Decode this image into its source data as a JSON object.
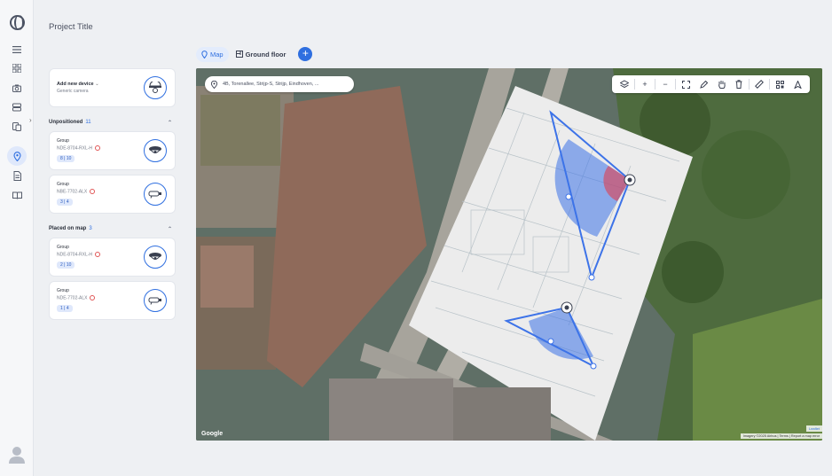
{
  "app": {
    "project_title": "Project Title"
  },
  "rail": {
    "items": [
      {
        "icon": "menu-icon"
      },
      {
        "icon": "grid-icon"
      },
      {
        "icon": "camera-icon"
      },
      {
        "icon": "server-icon"
      },
      {
        "icon": "devices-icon"
      },
      {
        "icon": "map-pin-icon",
        "active": true
      },
      {
        "icon": "document-icon"
      },
      {
        "icon": "book-icon"
      }
    ]
  },
  "panel": {
    "add_device": {
      "title": "Add new device",
      "subtitle": "Generic camera"
    },
    "unpositioned": {
      "label": "Unpositioned",
      "count": "11",
      "items": [
        {
          "group": "Group",
          "model": "NDE-8704-RXL-H",
          "chip": "8 | 10"
        },
        {
          "group": "Group",
          "model": "NBE-7702-ALX",
          "chip": "3 | 4"
        }
      ]
    },
    "placed": {
      "label": "Placed on map",
      "count": "3",
      "items": [
        {
          "group": "Group",
          "model": "NDE-8704-RXL-H",
          "chip": "2 | 10"
        },
        {
          "group": "Group",
          "model": "NDE-7702-ALX",
          "chip": "1 | 4"
        }
      ]
    }
  },
  "tabs": {
    "map": "Map",
    "ground_floor": "Ground floor",
    "add": "+"
  },
  "map": {
    "address": "4B, Torenallee, Strijp-S, Strijp, Eindhoven, ...",
    "google": "Google",
    "attribution": "Imagery ©2025 Airbus  |  Terms  |  Report a map error",
    "leaflet": "Leaflet",
    "toolbar": [
      {
        "icon": "layers-icon"
      },
      {
        "icon": "zoom-in-icon"
      },
      {
        "icon": "zoom-out-icon"
      },
      {
        "icon": "fit-icon"
      },
      {
        "icon": "draw-icon"
      },
      {
        "icon": "pan-icon"
      },
      {
        "icon": "delete-icon"
      },
      {
        "icon": "measure-icon"
      },
      {
        "icon": "qr-icon"
      },
      {
        "icon": "nav-icon"
      }
    ]
  },
  "colors": {
    "accent": "#2f6fe0",
    "coverage": "#3d73e8",
    "warning": "#e05555"
  }
}
